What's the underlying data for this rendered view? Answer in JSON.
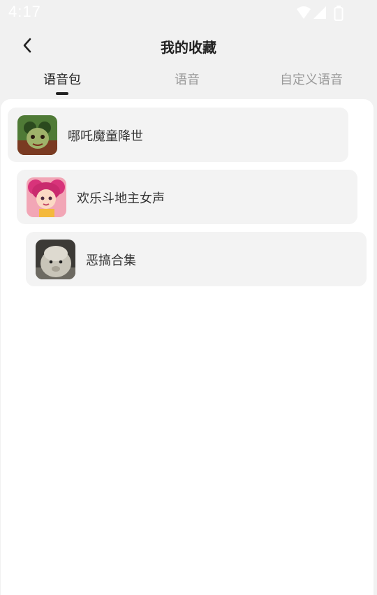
{
  "status_bar": {
    "time": "4:17",
    "icons": [
      "wifi-icon",
      "signal-icon",
      "battery-icon"
    ]
  },
  "nav": {
    "back_icon": "chevron-left-icon",
    "title": "我的收藏"
  },
  "tabs": [
    {
      "label": "语音包",
      "active": true
    },
    {
      "label": "语音",
      "active": false
    },
    {
      "label": "自定义语音",
      "active": false
    }
  ],
  "favorites": [
    {
      "name": "哪吒魔童降世",
      "thumbnail": "nezha-cartoon-avatar"
    },
    {
      "name": "欢乐斗地主女声",
      "thumbnail": "pink-hair-cartoon-girl-avatar"
    },
    {
      "name": "恶搞合集",
      "thumbnail": "alpaca-photo-avatar"
    }
  ],
  "colors": {
    "background": "#f1f1f1",
    "card": "#ffffff",
    "item_background": "#f3f3f3",
    "active_tab": "#222222",
    "inactive_tab": "#9a9a9a"
  }
}
